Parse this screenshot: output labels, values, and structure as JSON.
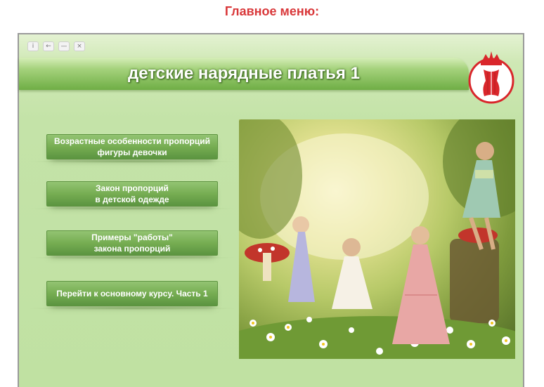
{
  "page": {
    "heading": "Главное меню:"
  },
  "window": {
    "controls": [
      {
        "icon": "info-icon",
        "glyph": "i"
      },
      {
        "icon": "back-arrow-icon",
        "glyph": "←"
      },
      {
        "icon": "minimize-icon",
        "glyph": "—"
      },
      {
        "icon": "close-icon",
        "glyph": "×"
      }
    ],
    "title": "детские нарядные платья 1"
  },
  "logo": {
    "icon": "corset-crown-logo-icon",
    "color": "#d9262b"
  },
  "menu": {
    "items": [
      {
        "label": "Возрастные особенности пропорций\nфигуры девочки"
      },
      {
        "label": "Закон пропорций\nв детской одежде"
      },
      {
        "label": "Примеры \"работы\"\nзакона пропорций"
      },
      {
        "label": "Перейти к основному курсу. Часть 1"
      }
    ]
  },
  "colors": {
    "heading": "#d9383a",
    "button": "#76ad52",
    "background": "#c4e3a8",
    "title_bar": "#7db44f"
  },
  "photo": {
    "subject": "girls-in-party-dresses-fairy-forest-image"
  }
}
